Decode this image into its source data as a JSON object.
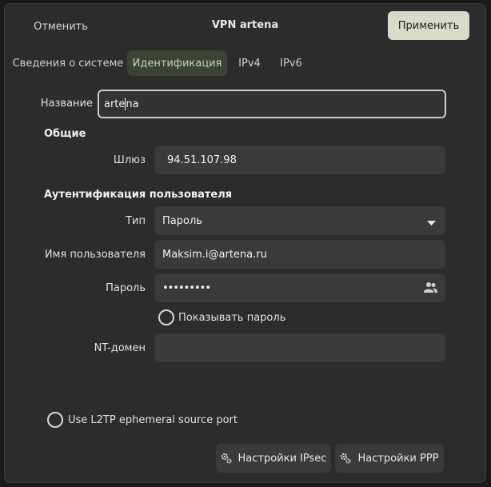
{
  "header": {
    "cancel_label": "Отменить",
    "title": "VPN artena",
    "apply_label": "Применить"
  },
  "tabs": [
    {
      "label": "Сведения о системе",
      "active": false
    },
    {
      "label": "Идентификация",
      "active": true
    },
    {
      "label": "IPv4",
      "active": false
    },
    {
      "label": "IPv6",
      "active": false
    }
  ],
  "name_field": {
    "label": "Название",
    "value_before_caret": "arte",
    "value_after_caret": "na"
  },
  "general": {
    "heading": "Общие",
    "gateway_label": "Шлюз",
    "gateway_value": "94.51.107.98"
  },
  "auth": {
    "heading": "Аутентификация пользователя",
    "type_label": "Тип",
    "type_value": "Пароль",
    "username_label": "Имя пользователя",
    "username_value": "Maksim.i@artena.ru",
    "password_label": "Пароль",
    "password_value": "•••••••••",
    "show_password_label": "Показывать пароль",
    "show_password_checked": false,
    "ntdomain_label": "NT-домен",
    "ntdomain_value": ""
  },
  "l2tp": {
    "label": "Use L2TP ephemeral source port",
    "checked": false
  },
  "footer": {
    "ipsec_label": "Настройки IPsec",
    "ppp_label": "Настройки PPP"
  },
  "colors": {
    "accent": "#d6dcc8",
    "active_tab_bg": "#3b4236",
    "active_tab_text": "#c2d8a8"
  }
}
